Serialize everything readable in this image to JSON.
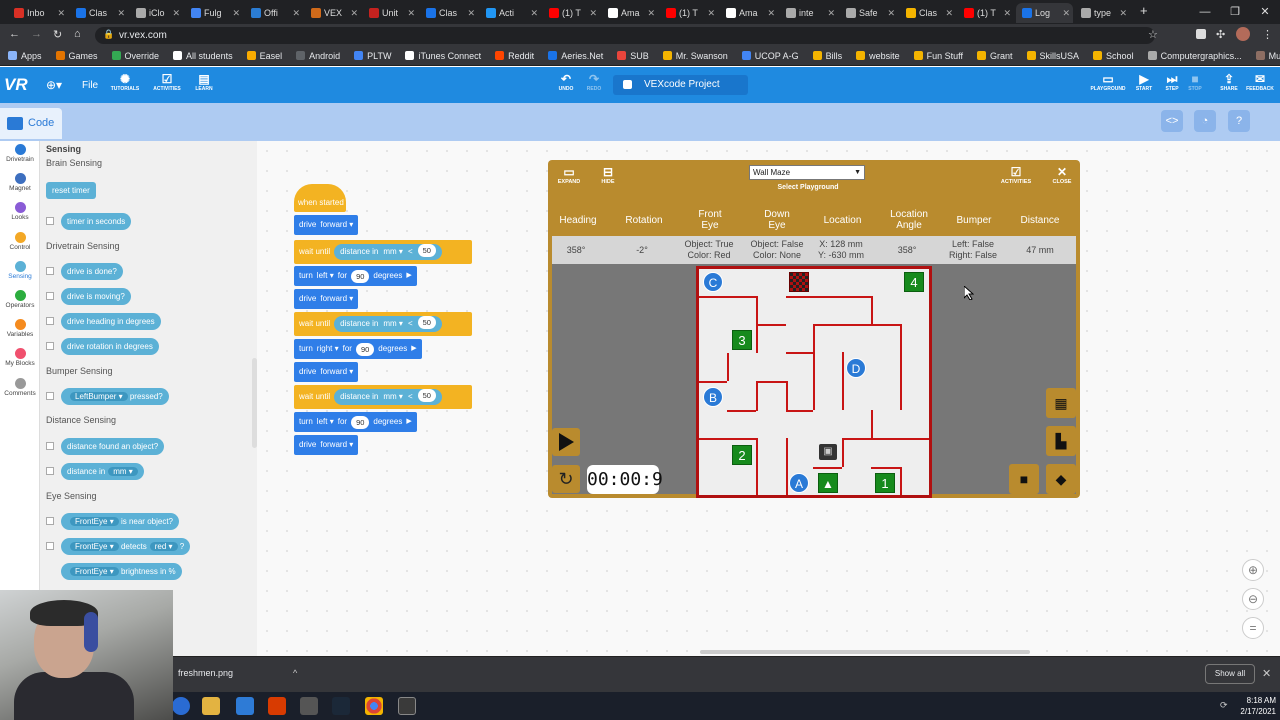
{
  "browser": {
    "tabs": [
      {
        "label": "Inbo",
        "color": "#d93025"
      },
      {
        "label": "Clas",
        "color": "#1a73e8"
      },
      {
        "label": "iClo",
        "color": "#aaaaaa"
      },
      {
        "label": "Fulg",
        "color": "#4285f4"
      },
      {
        "label": "Offi",
        "color": "#2b7cd3"
      },
      {
        "label": "VEX",
        "color": "#d06a1a"
      },
      {
        "label": "Unit",
        "color": "#c5221f"
      },
      {
        "label": "Clas",
        "color": "#1a73e8"
      },
      {
        "label": "Acti",
        "color": "#2196f3"
      },
      {
        "label": "(1) T",
        "color": "#ff0000"
      },
      {
        "label": "Ama",
        "color": "#ffffff"
      },
      {
        "label": "(1) T",
        "color": "#ff0000"
      },
      {
        "label": "Ama",
        "color": "#ffffff"
      },
      {
        "label": "inte",
        "color": "#aaaaaa"
      },
      {
        "label": "Safe",
        "color": "#aaaaaa"
      },
      {
        "label": "Clas",
        "color": "#f4b400"
      },
      {
        "label": "(1) T",
        "color": "#ff0000"
      },
      {
        "label": "Log",
        "color": "#1a73e8"
      },
      {
        "label": "type",
        "color": "#aaaaaa"
      }
    ],
    "url": "vr.vex.com",
    "bookmarks": [
      "Apps",
      "Games",
      "Override",
      "All students",
      "Easel",
      "Android",
      "PLTW",
      "iTunes Connect",
      "Reddit",
      "Aeries.Net",
      "SUB",
      "Mr. Swanson",
      "UCOP A-G",
      "Bills",
      "website",
      "Fun Stuff",
      "Grant",
      "SkillsUSA",
      "School",
      "Computergraphics...",
      "Multicraft"
    ]
  },
  "vr": {
    "logo": "VR",
    "file": "File",
    "tutorials": "TUTORIALS",
    "activities": "ACTIVITIES",
    "learn": "LEARN",
    "undo": "UNDO",
    "redo": "REDO",
    "project_title": "VEXcode Project",
    "playground_btn": "PLAYGROUND",
    "start": "START",
    "step": "STEP",
    "stop": "STOP",
    "share": "SHARE",
    "feedback": "FEEDBACK",
    "code_tab": "Code"
  },
  "categories": [
    {
      "label": "Drivetrain",
      "color": "#2a7ad6"
    },
    {
      "label": "Magnet",
      "color": "#3d6fbf"
    },
    {
      "label": "Looks",
      "color": "#8a5cd6"
    },
    {
      "label": "Control",
      "color": "#f3a826"
    },
    {
      "label": "Sensing",
      "color": "#5cb1d6"
    },
    {
      "label": "Operators",
      "color": "#2cad3e"
    },
    {
      "label": "Variables",
      "color": "#f58b1f"
    },
    {
      "label": "My Blocks",
      "color": "#f0506e"
    },
    {
      "label": "Comments",
      "color": "#999999"
    }
  ],
  "flyout": {
    "title": "Sensing",
    "brain": "Brain Sensing",
    "reset_timer": "reset timer",
    "timer_seconds": "timer in seconds",
    "drivetrain": "Drivetrain Sensing",
    "drive_done": "drive is done?",
    "drive_moving": "drive is moving?",
    "drive_heading": "drive heading in degrees",
    "drive_rotation": "drive rotation in degrees",
    "bumper": "Bumper Sensing",
    "left_bumper": "LeftBumper",
    "pressed": "pressed?",
    "distance": "Distance Sensing",
    "distance_found": "distance found an object?",
    "distance_in": "distance in",
    "mm": "mm",
    "eye": "Eye Sensing",
    "front_eye": "FrontEye",
    "near": "is near object?",
    "detects": "detects",
    "red": "red",
    "q": "?",
    "brightness": "brightness in %"
  },
  "script": {
    "hat": "when started",
    "drive": "drive",
    "forward": "forward",
    "wait_until": "wait until",
    "distance_in": "distance in",
    "mm": "mm",
    "lt": "<",
    "fifty": "50",
    "turn": "turn",
    "left": "left",
    "right": "right",
    "for": "for",
    "ninety": "90",
    "degrees": "degrees"
  },
  "playground": {
    "expand": "EXPAND",
    "hide": "HIDE",
    "selected": "Wall Maze",
    "select_label": "Select Playground",
    "activities": "ACTIVITIES",
    "close": "CLOSE",
    "headers": {
      "heading": "Heading",
      "rotation": "Rotation",
      "front_eye": "Front Eye",
      "down_eye": "Down Eye",
      "location": "Location",
      "location_angle": "Location Angle",
      "bumper": "Bumper",
      "distance": "Distance"
    },
    "values": {
      "heading": "358°",
      "rotation": "-2°",
      "front_eye_1": "Object: True",
      "front_eye_2": "Color: Red",
      "down_eye_1": "Object: False",
      "down_eye_2": "Color: None",
      "location_1": "X: 128 mm",
      "location_2": "Y: -630 mm",
      "location_angle": "358°",
      "bumper_1": "Left: False",
      "bumper_2": "Right: False",
      "distance": "47 mm"
    },
    "maze_numbers": [
      "4",
      "3",
      "2",
      "1"
    ],
    "maze_letters": [
      "C",
      "D",
      "B",
      "A"
    ],
    "timer": "00:00:9"
  },
  "download": {
    "file": "freshmen.png",
    "show_all": "Show all"
  },
  "clock": {
    "time": "8:18 AM",
    "date": "2/17/2021"
  }
}
